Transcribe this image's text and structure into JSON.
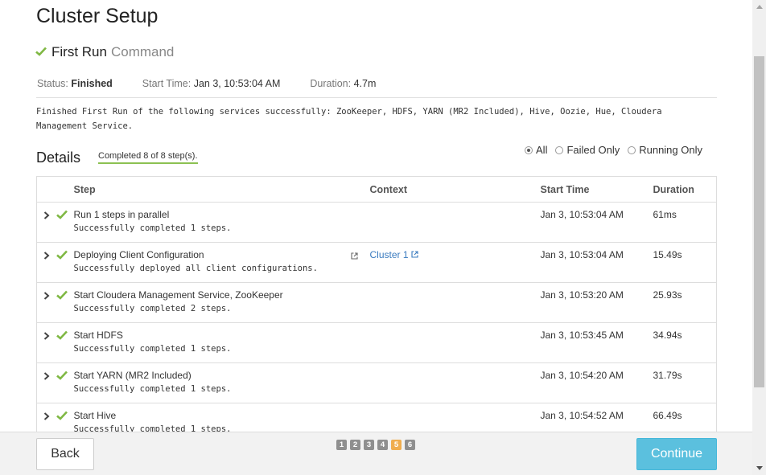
{
  "page": {
    "title": "Cluster Setup"
  },
  "command": {
    "title": "First Run",
    "suffix": "Command",
    "status_label": "Status:",
    "status_value": "Finished",
    "start_time_label": "Start Time:",
    "start_time_value": "Jan 3, 10:53:04 AM",
    "duration_label": "Duration:",
    "duration_value": "4.7m",
    "message_line1": "Finished First Run of the following services successfully: ZooKeeper, HDFS, YARN (MR2 Included), Hive, Oozie, Hue, Cloudera",
    "message_line2": "Management Service."
  },
  "details": {
    "heading": "Details",
    "progress_text": "Completed 8 of 8 step(s).",
    "filters": [
      {
        "label": "All",
        "selected": true
      },
      {
        "label": "Failed Only",
        "selected": false
      },
      {
        "label": "Running Only",
        "selected": false
      }
    ]
  },
  "table": {
    "headers": {
      "step": "Step",
      "context": "Context",
      "start_time": "Start Time",
      "duration": "Duration"
    },
    "rows": [
      {
        "step": "Run 1 steps in parallel",
        "desc": "Successfully completed 1 steps.",
        "context": "",
        "start_time": "Jan 3, 10:53:04 AM",
        "duration": "61ms"
      },
      {
        "step": "Deploying Client Configuration",
        "desc": "Successfully deployed all client configurations.",
        "context": "Cluster 1",
        "start_time": "Jan 3, 10:53:04 AM",
        "duration": "15.49s"
      },
      {
        "step": "Start Cloudera Management Service, ZooKeeper",
        "desc": "Successfully completed 2 steps.",
        "context": "",
        "start_time": "Jan 3, 10:53:20 AM",
        "duration": "25.93s"
      },
      {
        "step": "Start HDFS",
        "desc": "Successfully completed 1 steps.",
        "context": "",
        "start_time": "Jan 3, 10:53:45 AM",
        "duration": "34.94s"
      },
      {
        "step": "Start YARN (MR2 Included)",
        "desc": "Successfully completed 1 steps.",
        "context": "",
        "start_time": "Jan 3, 10:54:20 AM",
        "duration": "31.79s"
      },
      {
        "step": "Start Hive",
        "desc": "Successfully completed 1 steps.",
        "context": "",
        "start_time": "Jan 3, 10:54:52 AM",
        "duration": "66.49s"
      }
    ]
  },
  "footer": {
    "back_label": "Back",
    "continue_label": "Continue",
    "pages": [
      "1",
      "2",
      "3",
      "4",
      "5",
      "6"
    ],
    "active_page": "5"
  },
  "colors": {
    "success": "#7fb843",
    "accent": "#5bc0de",
    "link": "#3a7bbf",
    "pager_active": "#f0ad4e"
  },
  "icons": {
    "status": "check-icon",
    "expand": "chevron-right-icon",
    "external": "external-link-icon"
  }
}
